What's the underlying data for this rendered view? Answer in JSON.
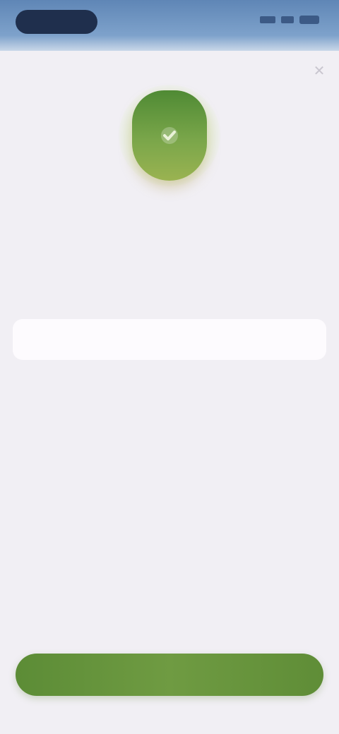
{
  "status_bar": {
    "time": "",
    "icons": [
      "signal-icon",
      "wifi-icon",
      "battery-icon"
    ]
  },
  "sheet": {
    "close_icon": "close-icon",
    "badge_icon": "shield-check-icon",
    "title": "",
    "subtitle": "",
    "field_label": "",
    "input_value": "",
    "input_placeholder": "",
    "primary_button_label": ""
  },
  "colors": {
    "status_bar": "#6f95c2",
    "background": "#f1eff4",
    "accent_green": "#6a9640",
    "input_background": "#fdfbfe"
  }
}
